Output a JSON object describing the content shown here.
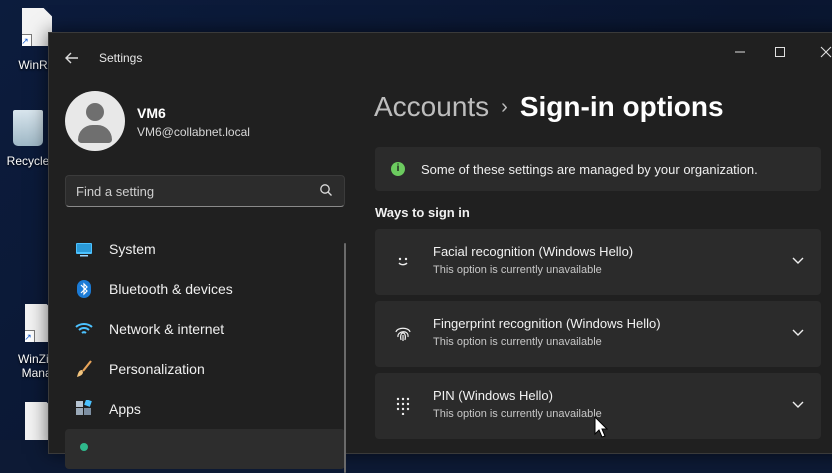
{
  "desktop": {
    "icons": [
      {
        "label": "WinRA",
        "kind": "file"
      },
      {
        "label": "Recycle",
        "kind": "recycle"
      },
      {
        "label": "WinZip I",
        "label2": "Manag",
        "kind": "file"
      },
      {
        "label": "",
        "kind": "file"
      }
    ]
  },
  "window": {
    "title": "Settings",
    "back_icon": "←",
    "minimize": "—",
    "maximize": "☐",
    "close": "✕"
  },
  "profile": {
    "name": "VM6",
    "email": "VM6@collabnet.local"
  },
  "search": {
    "placeholder": "Find a setting"
  },
  "nav": {
    "items": [
      {
        "label": "System",
        "icon": "monitor-icon"
      },
      {
        "label": "Bluetooth & devices",
        "icon": "bluetooth-icon"
      },
      {
        "label": "Network & internet",
        "icon": "wifi-icon"
      },
      {
        "label": "Personalization",
        "icon": "brush-icon"
      },
      {
        "label": "Apps",
        "icon": "apps-icon"
      },
      {
        "label": "",
        "icon": "accounts-icon"
      }
    ]
  },
  "breadcrumb": {
    "parent": "Accounts",
    "separator": "›",
    "current": "Sign-in options"
  },
  "banner": {
    "text": "Some of these settings are managed by your organization."
  },
  "section": {
    "title": "Ways to sign in"
  },
  "options": [
    {
      "title": "Facial recognition (Windows Hello)",
      "subtitle": "This option is currently unavailable",
      "icon": "face-icon"
    },
    {
      "title": "Fingerprint recognition (Windows Hello)",
      "subtitle": "This option is currently unavailable",
      "icon": "fingerprint-icon"
    },
    {
      "title": "PIN (Windows Hello)",
      "subtitle": "This option is currently unavailable",
      "icon": "pin-keypad-icon"
    }
  ],
  "colors": {
    "window_bg": "#202020",
    "card_bg": "#2b2b2b",
    "accent_green": "#6ccb5f",
    "accent_blue": "#4cc2ff"
  }
}
